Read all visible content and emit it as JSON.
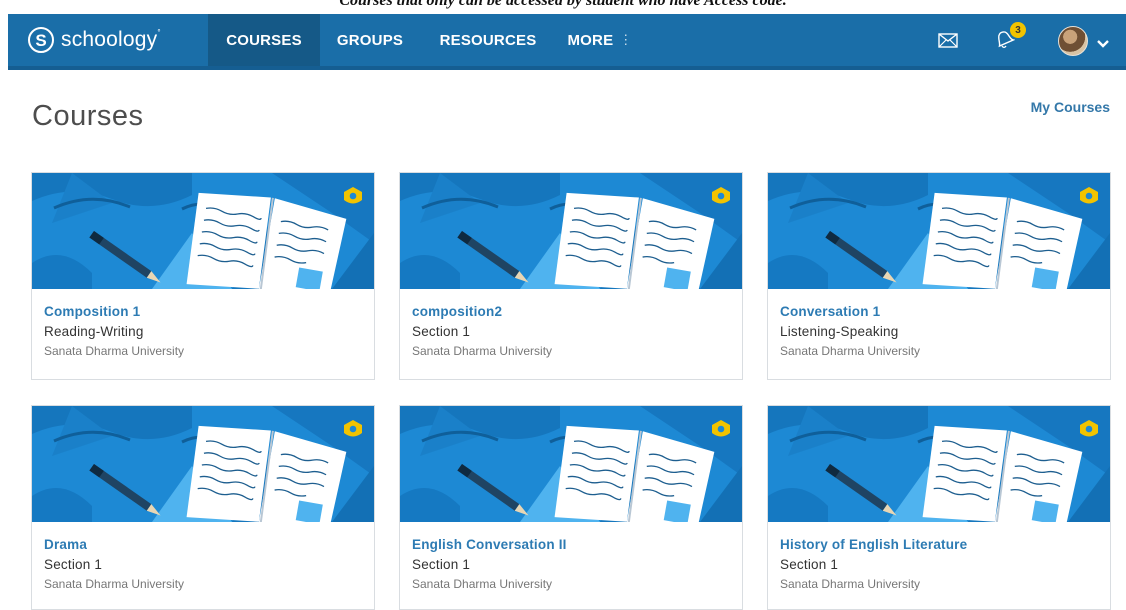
{
  "caption": "Courses that only can be accessed by student who have Access code.",
  "navbar": {
    "logo_text": "schoology",
    "logo_letter": "S",
    "items": [
      {
        "label": "COURSES",
        "active": true
      },
      {
        "label": "GROUPS"
      },
      {
        "label": "RESOURCES"
      },
      {
        "label": "MORE"
      }
    ],
    "icons": [
      "mail-icon",
      "bell-icon",
      "avatar",
      "chevron-down-icon"
    ],
    "notification_count": "3",
    "colors": {
      "bar": "#1a6ea8",
      "active": "#155987",
      "badge": "#f2c300"
    }
  },
  "page": {
    "title": "Courses",
    "my_courses_link": "My Courses"
  },
  "courses": [
    {
      "title": "Composition 1",
      "section": "Reading-Writing",
      "school": "Sanata Dharma University"
    },
    {
      "title": "composition2",
      "section": "Section 1",
      "school": "Sanata Dharma University"
    },
    {
      "title": "Conversation 1",
      "section": "Listening-Speaking",
      "school": "Sanata Dharma University"
    },
    {
      "title": "Drama",
      "section": "Section 1",
      "school": "Sanata Dharma University"
    },
    {
      "title": "English Conversation II",
      "section": "Section 1",
      "school": "Sanata Dharma University"
    },
    {
      "title": "History of English Literature",
      "section": "Section 1",
      "school": "Sanata Dharma University"
    }
  ],
  "card_colors": {
    "banner": "#1d89d4",
    "title": "#2d7bb3",
    "badge": "#f2c300"
  }
}
